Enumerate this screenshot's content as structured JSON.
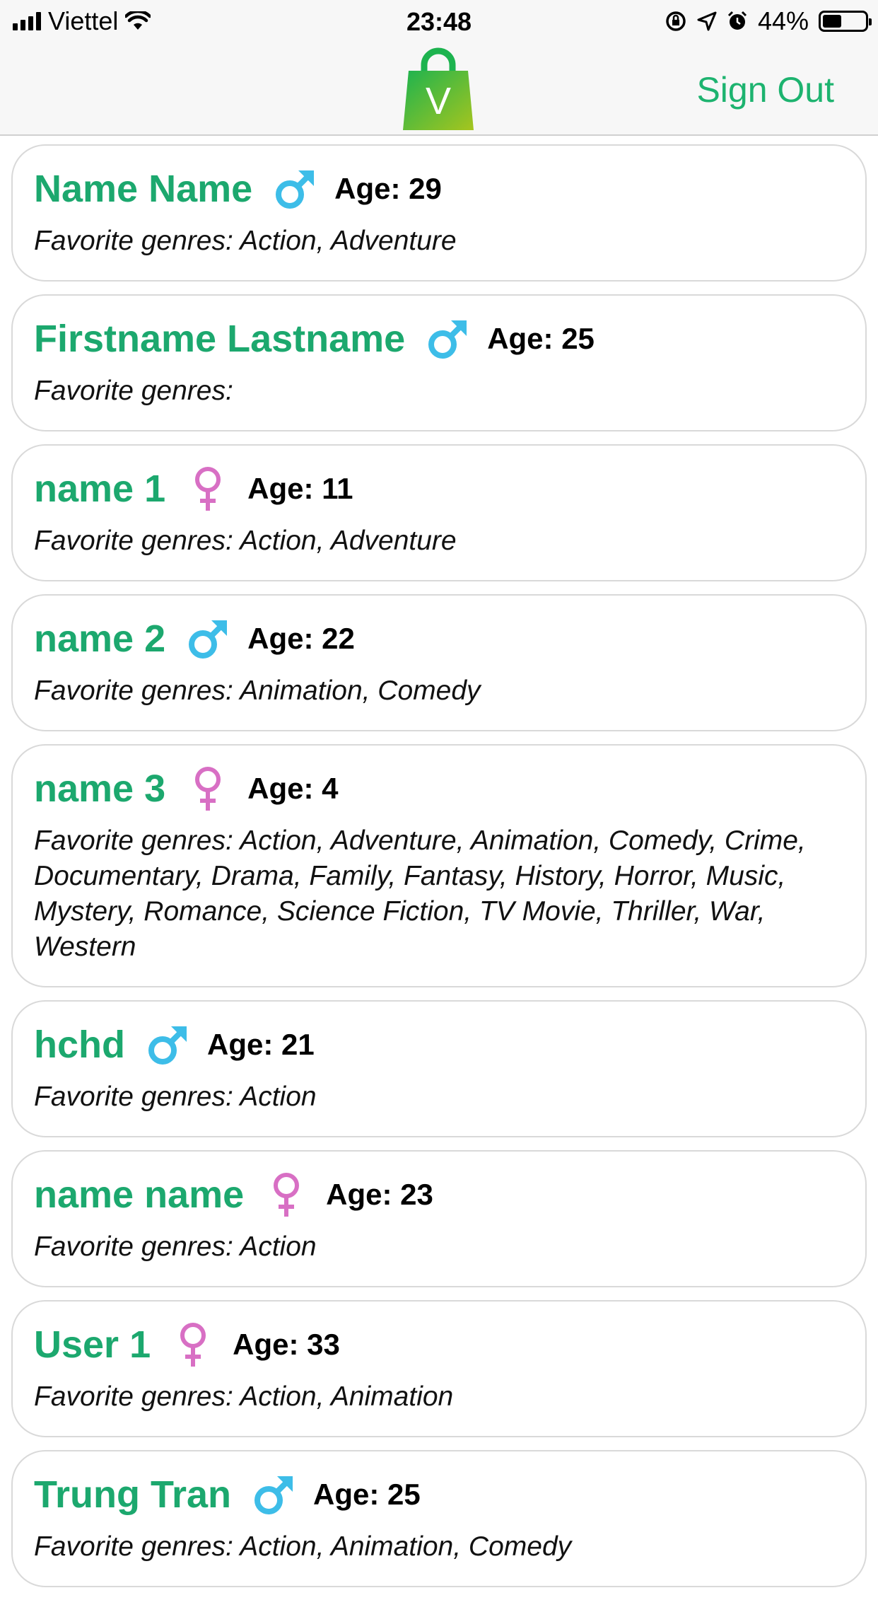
{
  "status_bar": {
    "carrier": "Viettel",
    "time": "23:48",
    "battery_percent": "44%",
    "battery_level": 0.44,
    "icons": [
      "signal-icon",
      "wifi-icon",
      "rotation-lock-icon",
      "location-icon",
      "alarm-icon",
      "battery-icon"
    ]
  },
  "nav": {
    "logo_letter": "V",
    "sign_out_label": "Sign Out"
  },
  "colors": {
    "name_green": "#1ca86e",
    "male_blue": "#3dbde8",
    "female_pink": "#d86fc4"
  },
  "users": [
    {
      "name": "Name Name",
      "gender": "male",
      "age": "Age: 29",
      "genres_label": "Favorite genres:",
      "genres": "Action, Adventure"
    },
    {
      "name": "Firstname Lastname",
      "gender": "male",
      "age": "Age: 25",
      "genres_label": "Favorite genres:",
      "genres": ""
    },
    {
      "name": "name 1",
      "gender": "female",
      "age": "Age: 11",
      "genres_label": "Favorite genres:",
      "genres": "Action, Adventure"
    },
    {
      "name": "name 2",
      "gender": "male",
      "age": "Age: 22",
      "genres_label": "Favorite genres:",
      "genres": "Animation, Comedy"
    },
    {
      "name": "name 3",
      "gender": "female",
      "age": "Age: 4",
      "genres_label": "Favorite genres:",
      "genres": "Action, Adventure, Animation, Comedy, Crime, Documentary, Drama, Family, Fantasy, History, Horror, Music, Mystery, Romance, Science Fiction, TV Movie, Thriller, War, Western"
    },
    {
      "name": "hchd",
      "gender": "male",
      "age": "Age: 21",
      "genres_label": "Favorite genres:",
      "genres": "Action"
    },
    {
      "name": "name name",
      "gender": "female",
      "age": "Age: 23",
      "genres_label": "Favorite genres:",
      "genres": "Action"
    },
    {
      "name": "User 1",
      "gender": "female",
      "age": "Age: 33",
      "genres_label": "Favorite genres:",
      "genres": "Action, Animation"
    },
    {
      "name": "Trung Tran",
      "gender": "male",
      "age": "Age: 25",
      "genres_label": "Favorite genres:",
      "genres": "Action, Animation, Comedy"
    }
  ]
}
